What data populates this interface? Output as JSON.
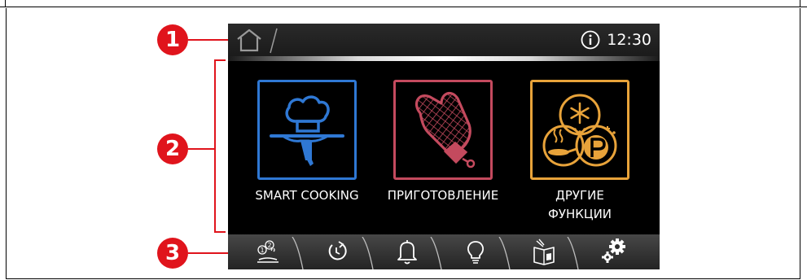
{
  "callouts": [
    "1",
    "2",
    "3"
  ],
  "status_bar": {
    "home_icon": "home-icon",
    "info_icon": "info-icon",
    "time": "12:30"
  },
  "tiles": [
    {
      "label": "SMART COOKING",
      "icon": "chef-hat-cloche-icon",
      "color": "#2f78d4"
    },
    {
      "label": "ПРИГОТОВЛЕНИЕ",
      "icon": "oven-mitt-icon",
      "color": "#c44a5e"
    },
    {
      "label_line1": "ДРУГИЕ",
      "label_line2": "ФУНКЦИИ",
      "icon": "snowflake-p-pan-icon",
      "color": "#e8a33a"
    }
  ],
  "tab_bar": {
    "tabs": [
      "recipe-steps-icon",
      "timer-icon",
      "bell-icon",
      "lightbulb-icon",
      "recipe-book-icon",
      "settings-gears-icon"
    ]
  },
  "colors": {
    "callout": "#e0141c",
    "screen": "#000000"
  }
}
